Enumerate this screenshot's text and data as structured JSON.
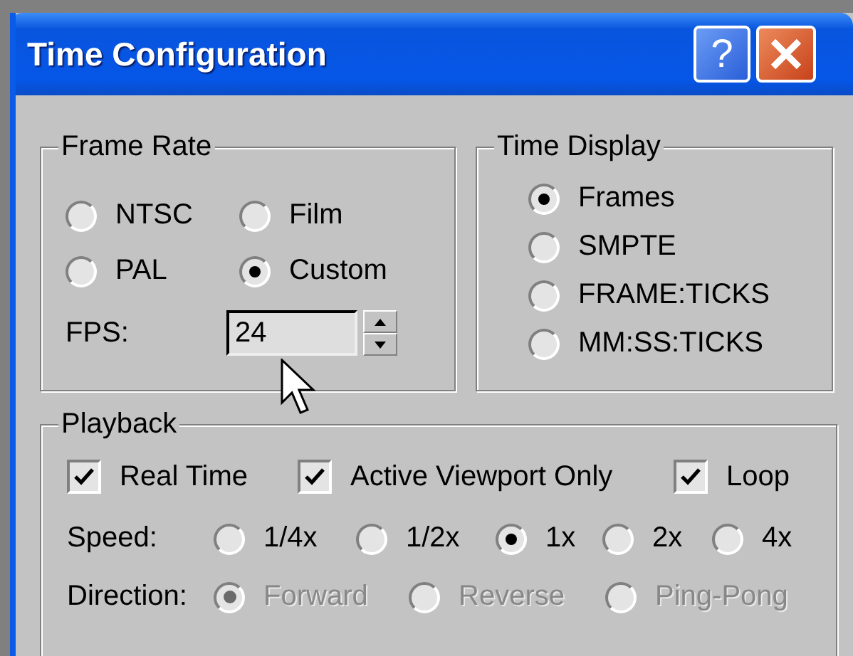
{
  "window": {
    "title": "Time Configuration",
    "help_button": "?"
  },
  "frame_rate": {
    "label": "Frame Rate",
    "options": [
      {
        "label": "NTSC",
        "selected": false
      },
      {
        "label": "Film",
        "selected": false
      },
      {
        "label": "PAL",
        "selected": false
      },
      {
        "label": "Custom",
        "selected": true
      }
    ],
    "fps": {
      "label": "FPS:",
      "value": "24"
    }
  },
  "time_display": {
    "label": "Time Display",
    "options": [
      {
        "label": "Frames",
        "selected": true
      },
      {
        "label": "SMPTE",
        "selected": false
      },
      {
        "label": "FRAME:TICKS",
        "selected": false
      },
      {
        "label": "MM:SS:TICKS",
        "selected": false
      }
    ]
  },
  "playback": {
    "label": "Playback",
    "checkboxes": [
      {
        "label": "Real Time",
        "checked": true
      },
      {
        "label": "Active Viewport Only",
        "checked": true
      },
      {
        "label": "Loop",
        "checked": true
      }
    ],
    "speed": {
      "label": "Speed:",
      "options": [
        {
          "label": "1/4x",
          "selected": false
        },
        {
          "label": "1/2x",
          "selected": false
        },
        {
          "label": "1x",
          "selected": true
        },
        {
          "label": "2x",
          "selected": false
        },
        {
          "label": "4x",
          "selected": false
        }
      ]
    },
    "direction": {
      "label": "Direction:",
      "disabled": true,
      "options": [
        {
          "label": "Forward",
          "selected": true
        },
        {
          "label": "Reverse",
          "selected": false
        },
        {
          "label": "Ping-Pong",
          "selected": false
        }
      ]
    }
  }
}
